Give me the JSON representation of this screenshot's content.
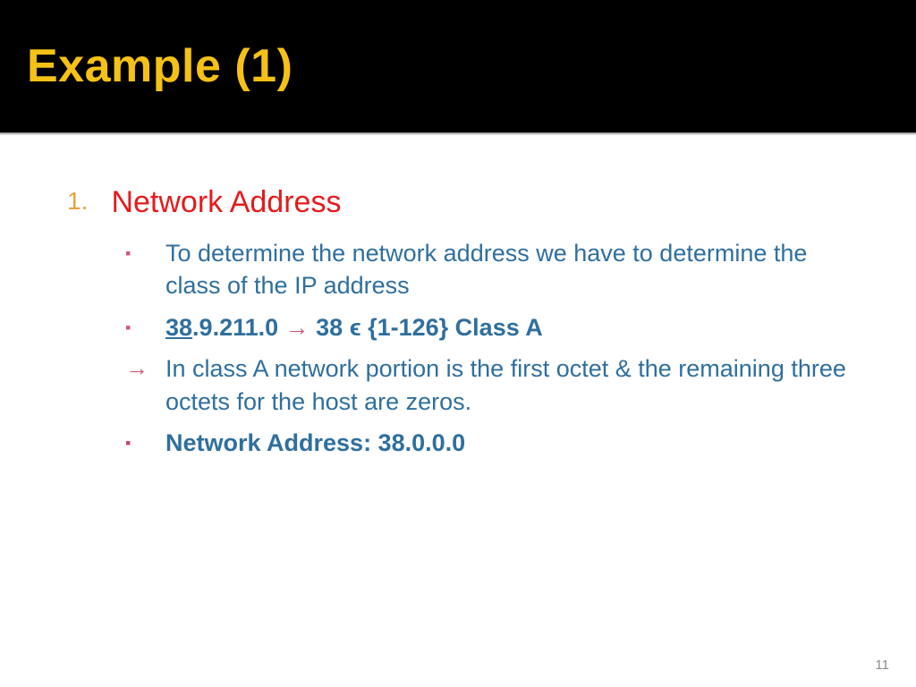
{
  "title": "Example (1)",
  "list_number": "1.",
  "heading": "Network Address",
  "items": {
    "i0": "To determine the network address we have to determine the class of the IP address",
    "i1_octet": "38",
    "i1_rest": ".9.211.0 ",
    "i1_arrow": "→",
    "i1_after": " 38 ϵ {1-126} Class A",
    "i2": "In class A network portion is the first octet & the remaining three octets for the host are zeros.",
    "i3": "Network Address: 38.0.0.0"
  },
  "page_number": "11"
}
